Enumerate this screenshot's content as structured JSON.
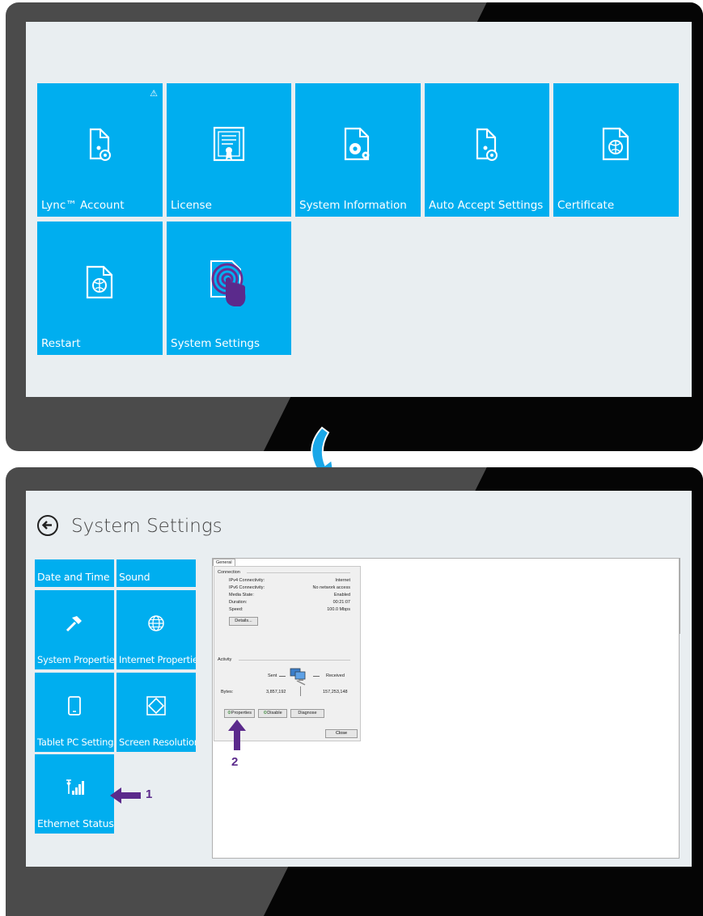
{
  "top_screen": {
    "tiles_row1": [
      {
        "label": "Lync™ Account",
        "icon": "document-gear-icon",
        "warning": "⚠"
      },
      {
        "label": "License",
        "icon": "certificate-icon"
      },
      {
        "label": "System Information",
        "icon": "document-gears-icon"
      },
      {
        "label": "Auto Accept Settings",
        "icon": "document-gear-icon"
      },
      {
        "label": "Certificate",
        "icon": "document-globe-icon"
      }
    ],
    "tiles_row2": [
      {
        "label": "Restart",
        "icon": "document-globe-icon"
      },
      {
        "label": "System Settings",
        "icon": "touch-hand-icon"
      }
    ]
  },
  "bottom_screen": {
    "title": "System Settings",
    "tiles": [
      {
        "label": "Date and Time"
      },
      {
        "label": "Sound"
      },
      {
        "label": "System Properties",
        "icon": "hammer-icon"
      },
      {
        "label": "Internet Properties",
        "icon": "globe-icon"
      },
      {
        "label": "Tablet PC Settings",
        "icon": "tablet-icon"
      },
      {
        "label": "Screen Resolution",
        "icon": "screen-diamond-icon"
      },
      {
        "label": "Ethernet Status",
        "icon": "signal-bars-icon"
      }
    ],
    "dialog": {
      "tab": "General",
      "connection_header": "Connection",
      "rows": [
        {
          "label": "IPv4 Connectivity:",
          "value": "Internet"
        },
        {
          "label": "IPv6 Connectivity:",
          "value": "No network access"
        },
        {
          "label": "Media State:",
          "value": "Enabled"
        },
        {
          "label": "Duration:",
          "value": "00:21:07"
        },
        {
          "label": "Speed:",
          "value": "100.0 Mbps"
        }
      ],
      "details_button": "Details...",
      "activity_header": "Activity",
      "sent_label": "Sent",
      "received_label": "Received",
      "bytes_label": "Bytes:",
      "bytes_sent": "3,857,192",
      "bytes_received": "157,253,148",
      "properties_button": "Properties",
      "disable_button": "Disable",
      "diagnose_button": "Diagnose",
      "close_button": "Close"
    },
    "callouts": {
      "one": "1",
      "two": "2"
    }
  },
  "colors": {
    "tile": "#00aeef",
    "screen": "#e9eef1",
    "callout": "#5b2a8c",
    "transition_arrow": "#1aa7e8"
  }
}
